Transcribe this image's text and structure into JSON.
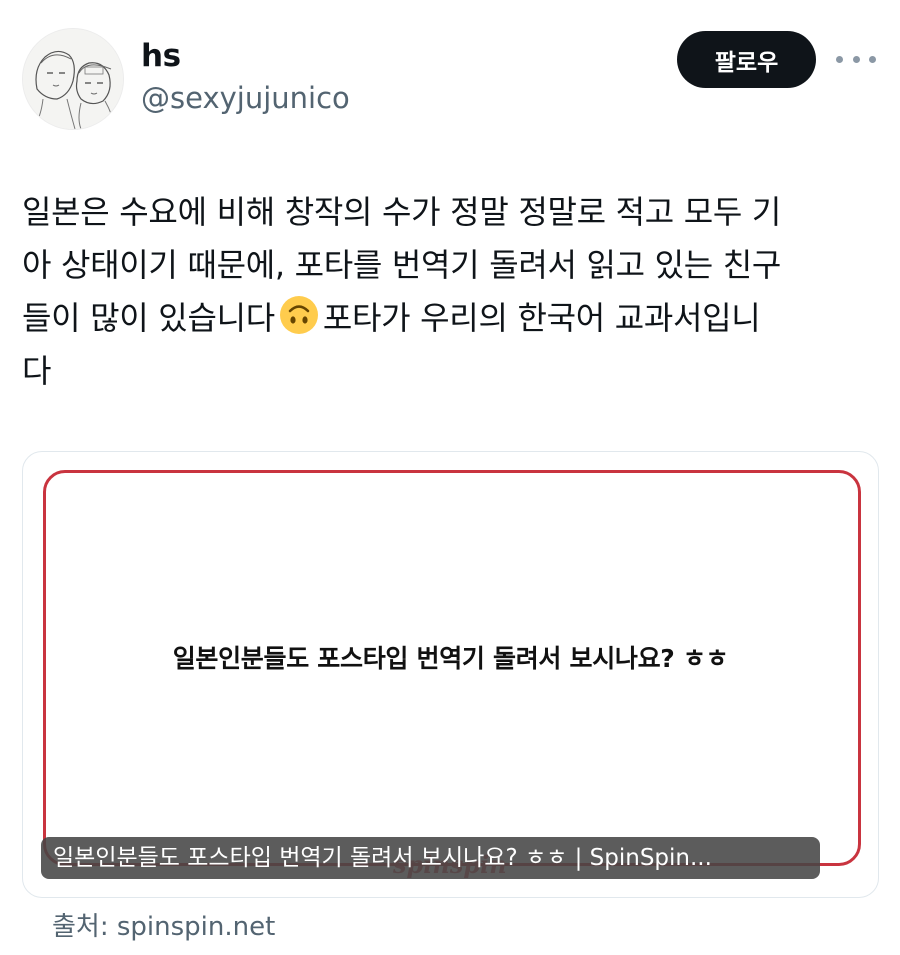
{
  "author": {
    "display_name": "hs",
    "handle": "@sexyjujunico"
  },
  "header": {
    "follow_label": "팔로우",
    "more_icon": "more-horizontal-icon"
  },
  "tweet": {
    "lines": [
      "일본은 수요에 비해 창작의 수가 정말 정말로 적고 모두 기",
      "아 상태이기 때문에, 포타를 번역기 돌려서 읽고 있는 친구",
      "들이 많이 있습니다",
      "포타가 우리의 한국어 교과서입니",
      "다"
    ],
    "emoji": "upside-down-face-emoji"
  },
  "card": {
    "headline": "일본인분들도 포스타입 번역기 돌려서 보시나요? ㅎㅎ",
    "watermark": "spinspin",
    "caption": "일본인분들도 포스타입 번역기 돌려서 보시나요? ㅎㅎ | SpinSpin...",
    "border_color": "#c9343f"
  },
  "source": {
    "label": "출처:",
    "domain": "spinspin.net"
  },
  "colors": {
    "text": "#0f1419",
    "secondary": "#536471",
    "button_bg": "#0f1419",
    "accent_red": "#c9343f"
  }
}
